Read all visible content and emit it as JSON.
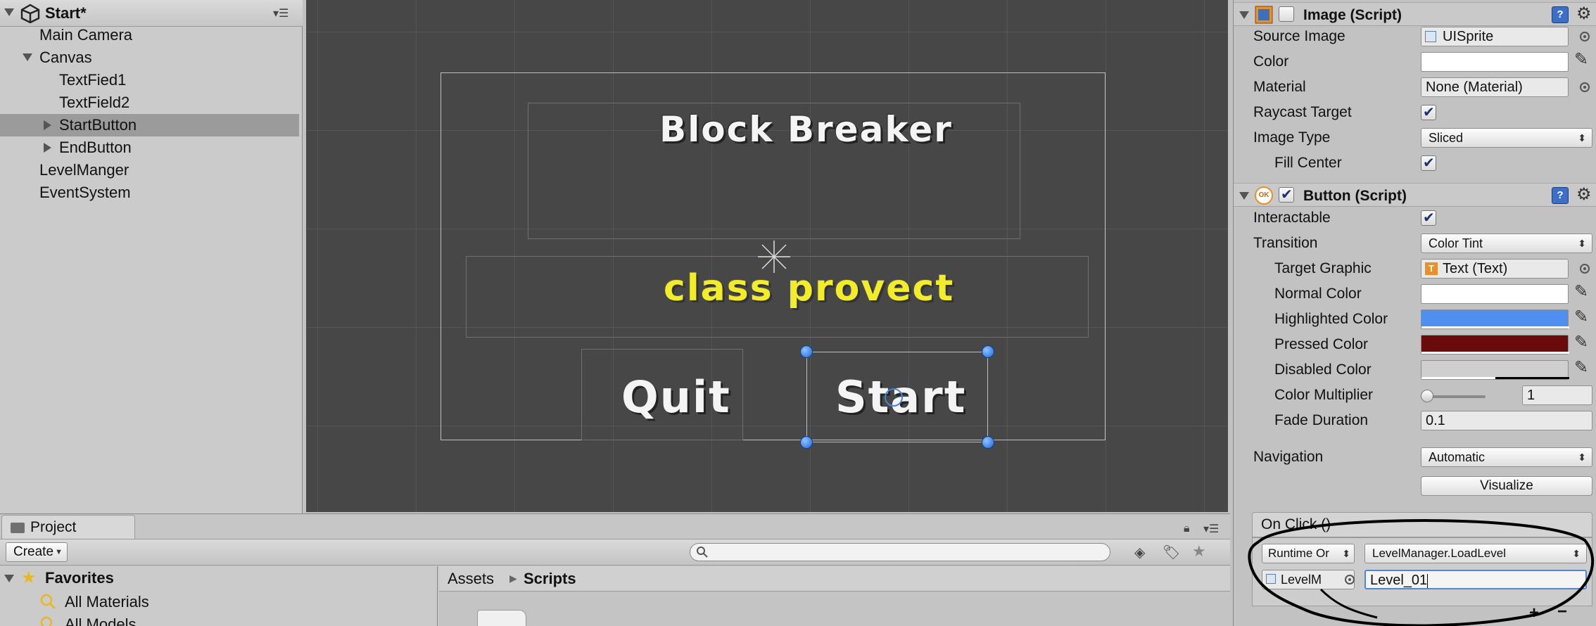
{
  "hierarchy": {
    "title": "Start*",
    "items": [
      {
        "label": "Main Camera"
      },
      {
        "label": "Canvas"
      },
      {
        "label": "TextFied1"
      },
      {
        "label": "TextField2"
      },
      {
        "label": "StartButton"
      },
      {
        "label": "EndButton"
      },
      {
        "label": "LevelManger"
      },
      {
        "label": "EventSystem"
      }
    ]
  },
  "scene": {
    "title_text": "Block Breaker",
    "subtitle_text": "class provect",
    "quit_text": "Quit",
    "start_text": "Start"
  },
  "inspector": {
    "image": {
      "title": "Image (Script)",
      "enabled": false,
      "source_image_label": "Source Image",
      "source_image_value": "UISprite",
      "color_label": "Color",
      "material_label": "Material",
      "material_value": "None (Material)",
      "raycast_label": "Raycast Target",
      "raycast": true,
      "image_type_label": "Image Type",
      "image_type_value": "Sliced",
      "fill_center_label": "Fill Center",
      "fill_center": true
    },
    "button": {
      "title": "Button (Script)",
      "icon_text": "OK",
      "enabled": true,
      "interactable_label": "Interactable",
      "interactable": true,
      "transition_label": "Transition",
      "transition_value": "Color Tint",
      "target_graphic_label": "Target Graphic",
      "target_graphic_value": "Text (Text)",
      "normal_color_label": "Normal Color",
      "highlighted_color_label": "Highlighted Color",
      "pressed_color_label": "Pressed Color",
      "disabled_color_label": "Disabled Color",
      "color_multiplier_label": "Color Multiplier",
      "color_multiplier_value": "1",
      "fade_duration_label": "Fade Duration",
      "fade_duration_value": "0.1",
      "navigation_label": "Navigation",
      "navigation_value": "Automatic",
      "visualize_label": "Visualize"
    },
    "on_click": {
      "title": "On Click ()",
      "runtime_value": "Runtime Or",
      "function_value": "LevelManager.LoadLevel",
      "object_value": "LevelM",
      "argument_value": "Level_01",
      "add_label": "+",
      "remove_label": "−"
    },
    "colors": {
      "color": "#ffffff",
      "normal": "#ffffff",
      "highlighted": "#4f8ff0",
      "pressed": "#6b0a0a",
      "disabled": "#cfcfcf"
    }
  },
  "project": {
    "tab_label": "Project",
    "create_label": "Create",
    "favorites_label": "Favorites",
    "favorites_items": [
      {
        "label": "All Materials"
      },
      {
        "label": "All Models"
      }
    ],
    "breadcrumb": [
      "Assets",
      "Scripts"
    ]
  }
}
